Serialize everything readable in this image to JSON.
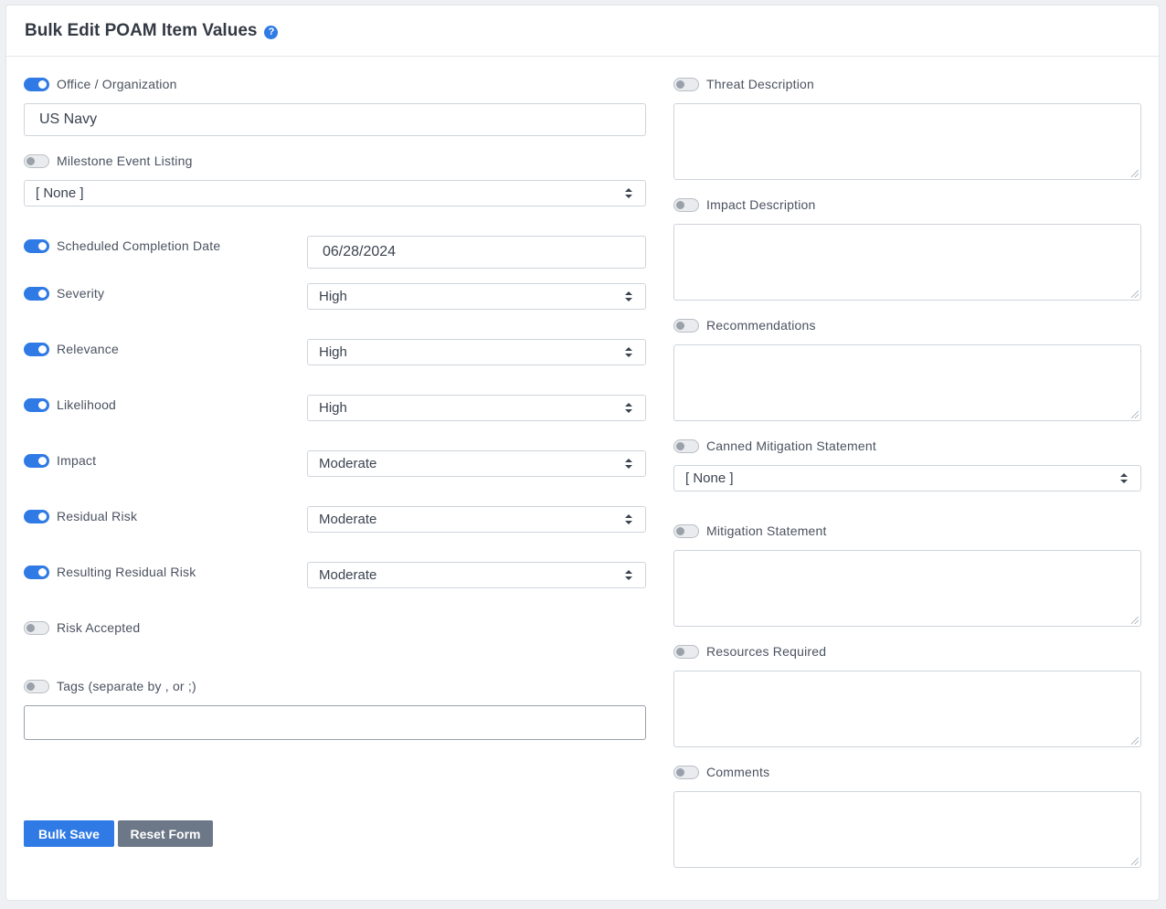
{
  "header": {
    "title": "Bulk Edit POAM Item Values",
    "help_icon": "?"
  },
  "left": {
    "office": {
      "label": "Office / Organization",
      "value": "US Navy",
      "enabled": true
    },
    "milestone": {
      "label": "Milestone Event Listing",
      "value": "[ None ]",
      "enabled": false
    },
    "scheduled_date": {
      "label": "Scheduled Completion Date",
      "value": "06/28/2024",
      "enabled": true
    },
    "severity": {
      "label": "Severity",
      "value": "High",
      "enabled": true
    },
    "relevance": {
      "label": "Relevance",
      "value": "High",
      "enabled": true
    },
    "likelihood": {
      "label": "Likelihood",
      "value": "High",
      "enabled": true
    },
    "impact": {
      "label": "Impact",
      "value": "Moderate",
      "enabled": true
    },
    "residual_risk": {
      "label": "Residual Risk",
      "value": "Moderate",
      "enabled": true
    },
    "resulting_residual_risk": {
      "label": "Resulting Residual Risk",
      "value": "Moderate",
      "enabled": true
    },
    "risk_accepted": {
      "label": "Risk Accepted",
      "enabled": false
    },
    "tags": {
      "label": "Tags (separate by , or ;)",
      "value": "",
      "enabled": false
    }
  },
  "right": {
    "threat_description": {
      "label": "Threat Description",
      "enabled": false
    },
    "impact_description": {
      "label": "Impact Description",
      "enabled": false
    },
    "recommendations": {
      "label": "Recommendations",
      "enabled": false
    },
    "canned_mitigation": {
      "label": "Canned Mitigation Statement",
      "value": "[ None ]",
      "enabled": false
    },
    "mitigation_statement": {
      "label": "Mitigation Statement",
      "enabled": false
    },
    "resources_required": {
      "label": "Resources Required",
      "enabled": false
    },
    "comments": {
      "label": "Comments",
      "enabled": false
    }
  },
  "actions": {
    "bulk_save": "Bulk Save",
    "reset_form": "Reset Form"
  },
  "colors": {
    "accent": "#2f7ae5",
    "secondary": "#6c7787"
  }
}
